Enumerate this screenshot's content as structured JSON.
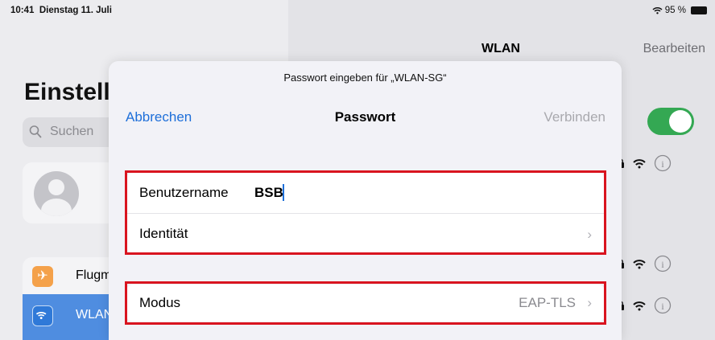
{
  "status_bar": {
    "time": "10:41",
    "date": "Dienstag 11. Juli",
    "battery": "95 %"
  },
  "sidebar": {
    "title": "Einstellungen",
    "search_placeholder": "Suchen",
    "items": [
      {
        "label": "Flugmodus",
        "icon": "airplane-icon",
        "color": "#f4a14a"
      },
      {
        "label": "WLAN",
        "icon": "wifi-icon",
        "selected": true
      }
    ]
  },
  "detail": {
    "title": "WLAN",
    "edit_label": "Bearbeiten",
    "wlan_enabled": true,
    "toggle_color": "#34a853"
  },
  "dialog": {
    "prompt": "Passwort eingeben für „WLAN-SG“",
    "cancel_label": "Abbrechen",
    "title": "Passwort",
    "connect_label": "Verbinden",
    "fields": [
      {
        "label": "Benutzername",
        "value": "BSB"
      },
      {
        "label": "Identität",
        "value": ""
      }
    ],
    "mode": {
      "label": "Modus",
      "value": "EAP-TLS"
    }
  },
  "accent_color": "#1e6fd9",
  "highlight_color": "#d9141f"
}
